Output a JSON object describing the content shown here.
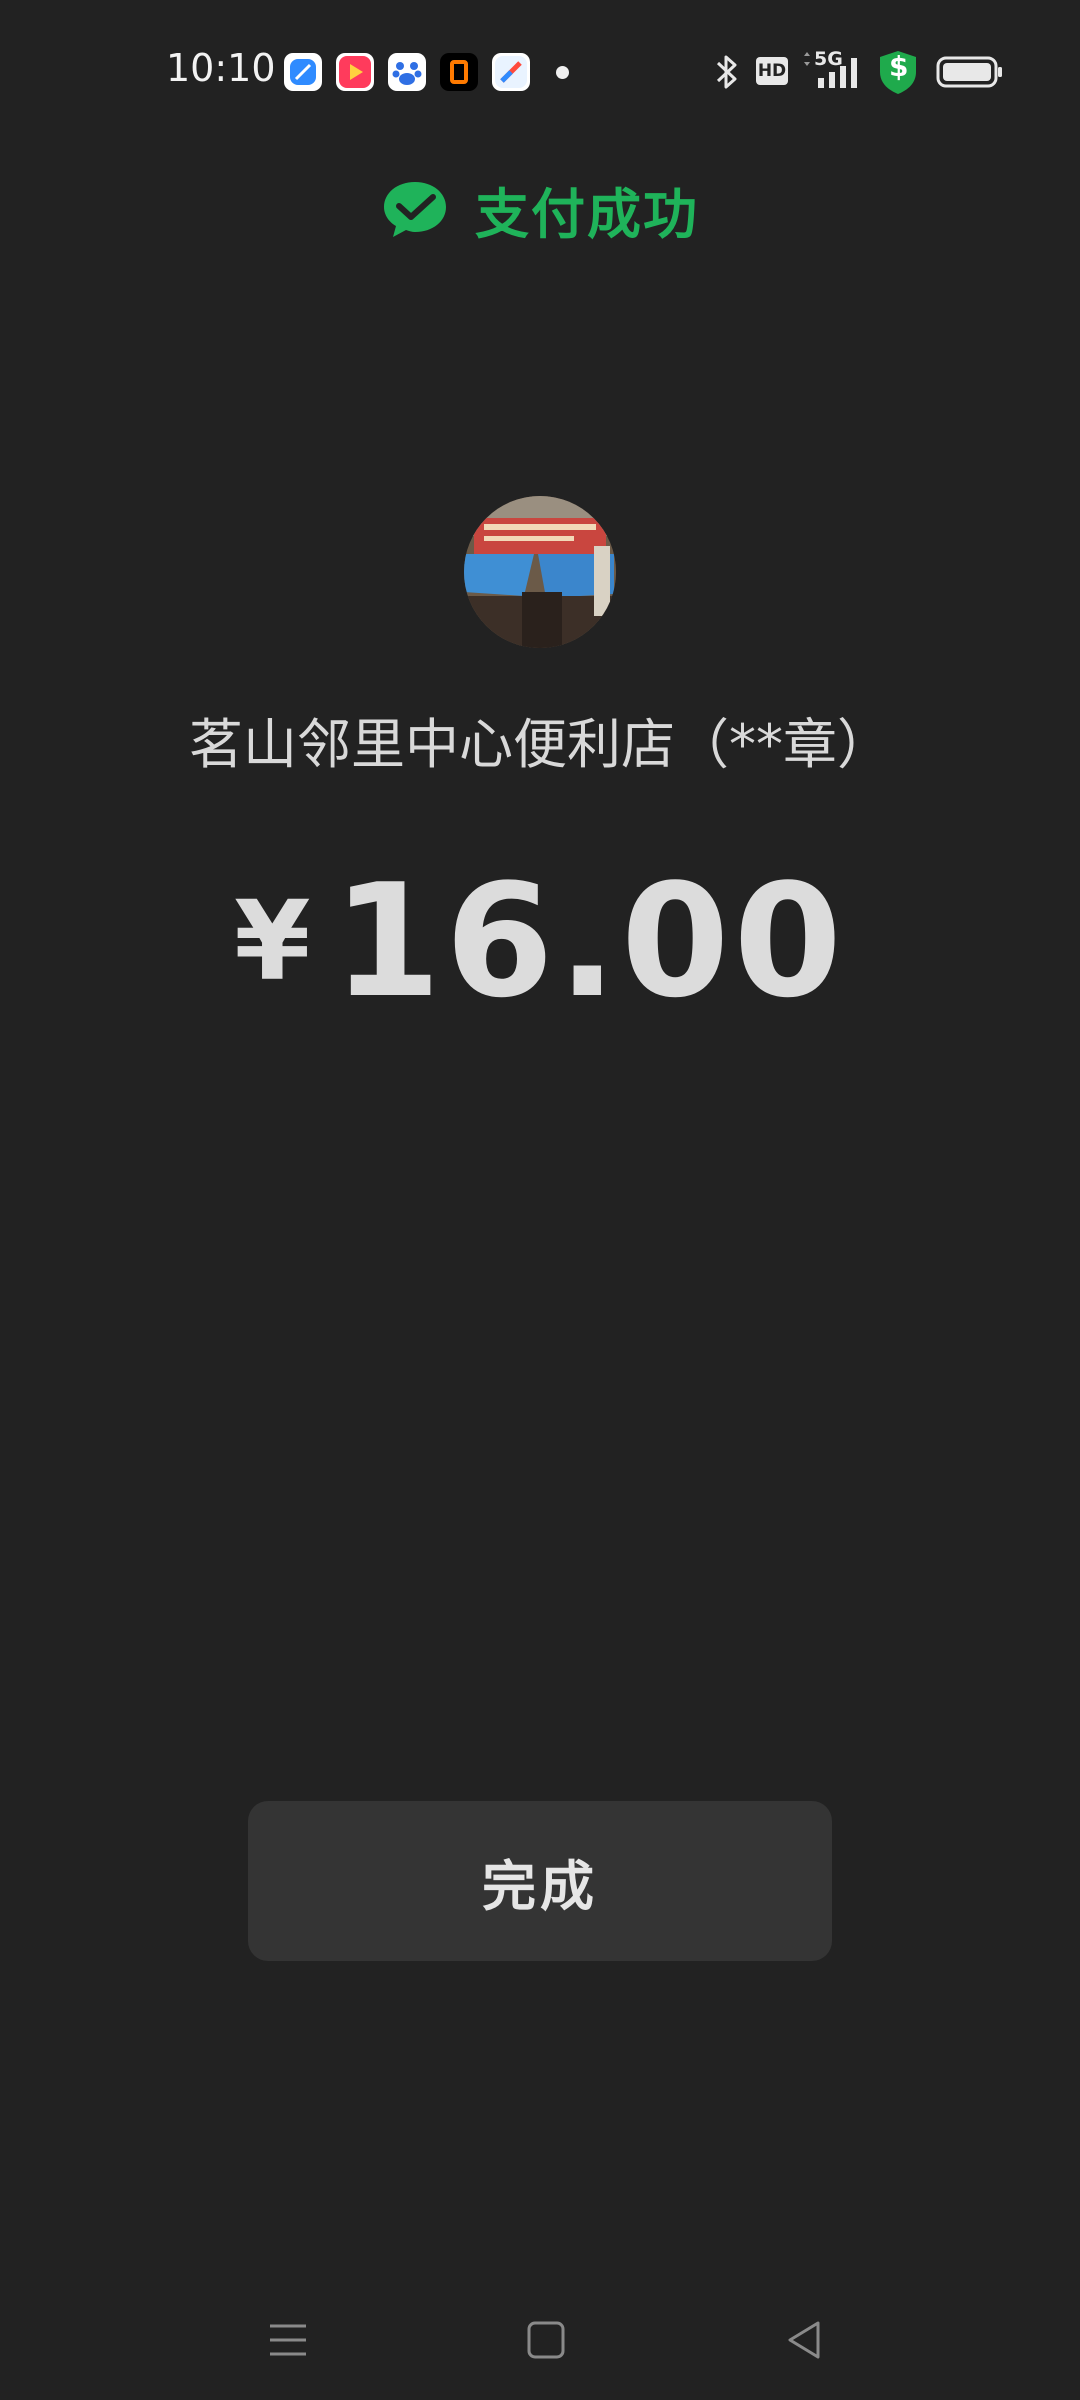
{
  "status_bar": {
    "time": "10:10",
    "app_icons": [
      "blue-app-icon",
      "video-app-icon",
      "baidu-map-icon",
      "orange-square-app-icon",
      "compass-app-icon"
    ],
    "hd_label": "HD",
    "network_label": "5G",
    "shield_symbol": "$",
    "right_icons": [
      "bluetooth-icon",
      "hd-icon",
      "signal-5g-icon",
      "security-shield-icon",
      "battery-icon"
    ]
  },
  "header": {
    "title": "支付成功",
    "icon": "wechat-pay-check-icon",
    "color": "#1fb35a"
  },
  "merchant": {
    "name": "茗山邻里中心便利店（**章）",
    "avatar": "storefront-photo"
  },
  "payment": {
    "currency_symbol": "¥",
    "amount": "16.00"
  },
  "actions": {
    "done_label": "完成"
  },
  "nav": {
    "items": [
      "menu-icon",
      "home-square-icon",
      "back-triangle-icon"
    ]
  }
}
